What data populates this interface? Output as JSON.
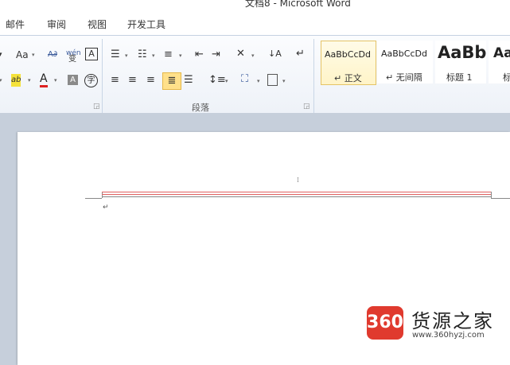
{
  "window": {
    "title": "文档8 - Microsoft Word"
  },
  "tabs": [
    {
      "label": "邮件"
    },
    {
      "label": "审阅"
    },
    {
      "label": "视图"
    },
    {
      "label": "开发工具"
    }
  ],
  "ribbon": {
    "font_group": {
      "change_case_label": "Aa",
      "pinyin_label": "wén",
      "phonetic_label": "变",
      "char_border_label": "A",
      "highlight_label": "ab",
      "font_color_label": "A",
      "char_shading_label": "A",
      "enclose_label": "字"
    },
    "paragraph_group": {
      "label": "段落"
    },
    "styles": [
      {
        "sample": "AaBbCcDd",
        "name": "↵ 正文",
        "active": true
      },
      {
        "sample": "AaBbCcDd",
        "name": "↵ 无间隔",
        "active": false
      },
      {
        "sample": "AaBb",
        "name": "标题 1",
        "active": false
      },
      {
        "sample": "Aa",
        "name": "标",
        "active": false
      }
    ]
  },
  "watermark": {
    "logo": "360",
    "name": "货源之家",
    "url": "www.360hyzj.com"
  },
  "colors": {
    "accent_red": "#e03a2e",
    "ribbon_border": "#c5d2e2",
    "doc_background": "#c6cfdb",
    "header_red": "#e06060"
  }
}
